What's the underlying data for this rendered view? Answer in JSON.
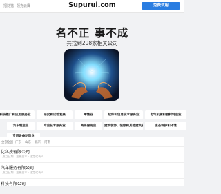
{
  "header": {
    "nav_left": "招财猫",
    "nav_left2": "领克云鹰",
    "logo": "Supurui.com",
    "cta": "免费试用"
  },
  "hero": {
    "title": "名不正 事不成",
    "subtitle": "共找到298家相关公司"
  },
  "categories": [
    {
      "label": "科技推广和应用服务业"
    },
    {
      "label": "研究和试验发展"
    },
    {
      "label": "零售业"
    },
    {
      "label": "软件和信息技术服务业"
    },
    {
      "label": "电气机械和器材制造业"
    },
    {
      "label": "汽车制造业"
    },
    {
      "label": "专业技术服务业"
    },
    {
      "label": "商务服务业"
    },
    {
      "label": "建筑装饰、装修和其他建筑业"
    },
    {
      "label": "生态保护和环境"
    },
    {
      "label": "专用设备制造业"
    }
  ],
  "filters": [
    "全部",
    "全国",
    "广东",
    "山东",
    "北京",
    "河南"
  ],
  "companies": [
    {
      "name": "化科技有限公司",
      "meta": "· 成立日期 · 注册资本 · 法定代表人"
    },
    {
      "name": "汽车服务有限公司",
      "meta": "· 成立日期 · 注册资本 · 法定代表人"
    },
    {
      "name": "科技有限公司",
      "meta": ""
    }
  ],
  "colors": {
    "accent": "#2a7de1",
    "background": "#f1f2f4"
  }
}
